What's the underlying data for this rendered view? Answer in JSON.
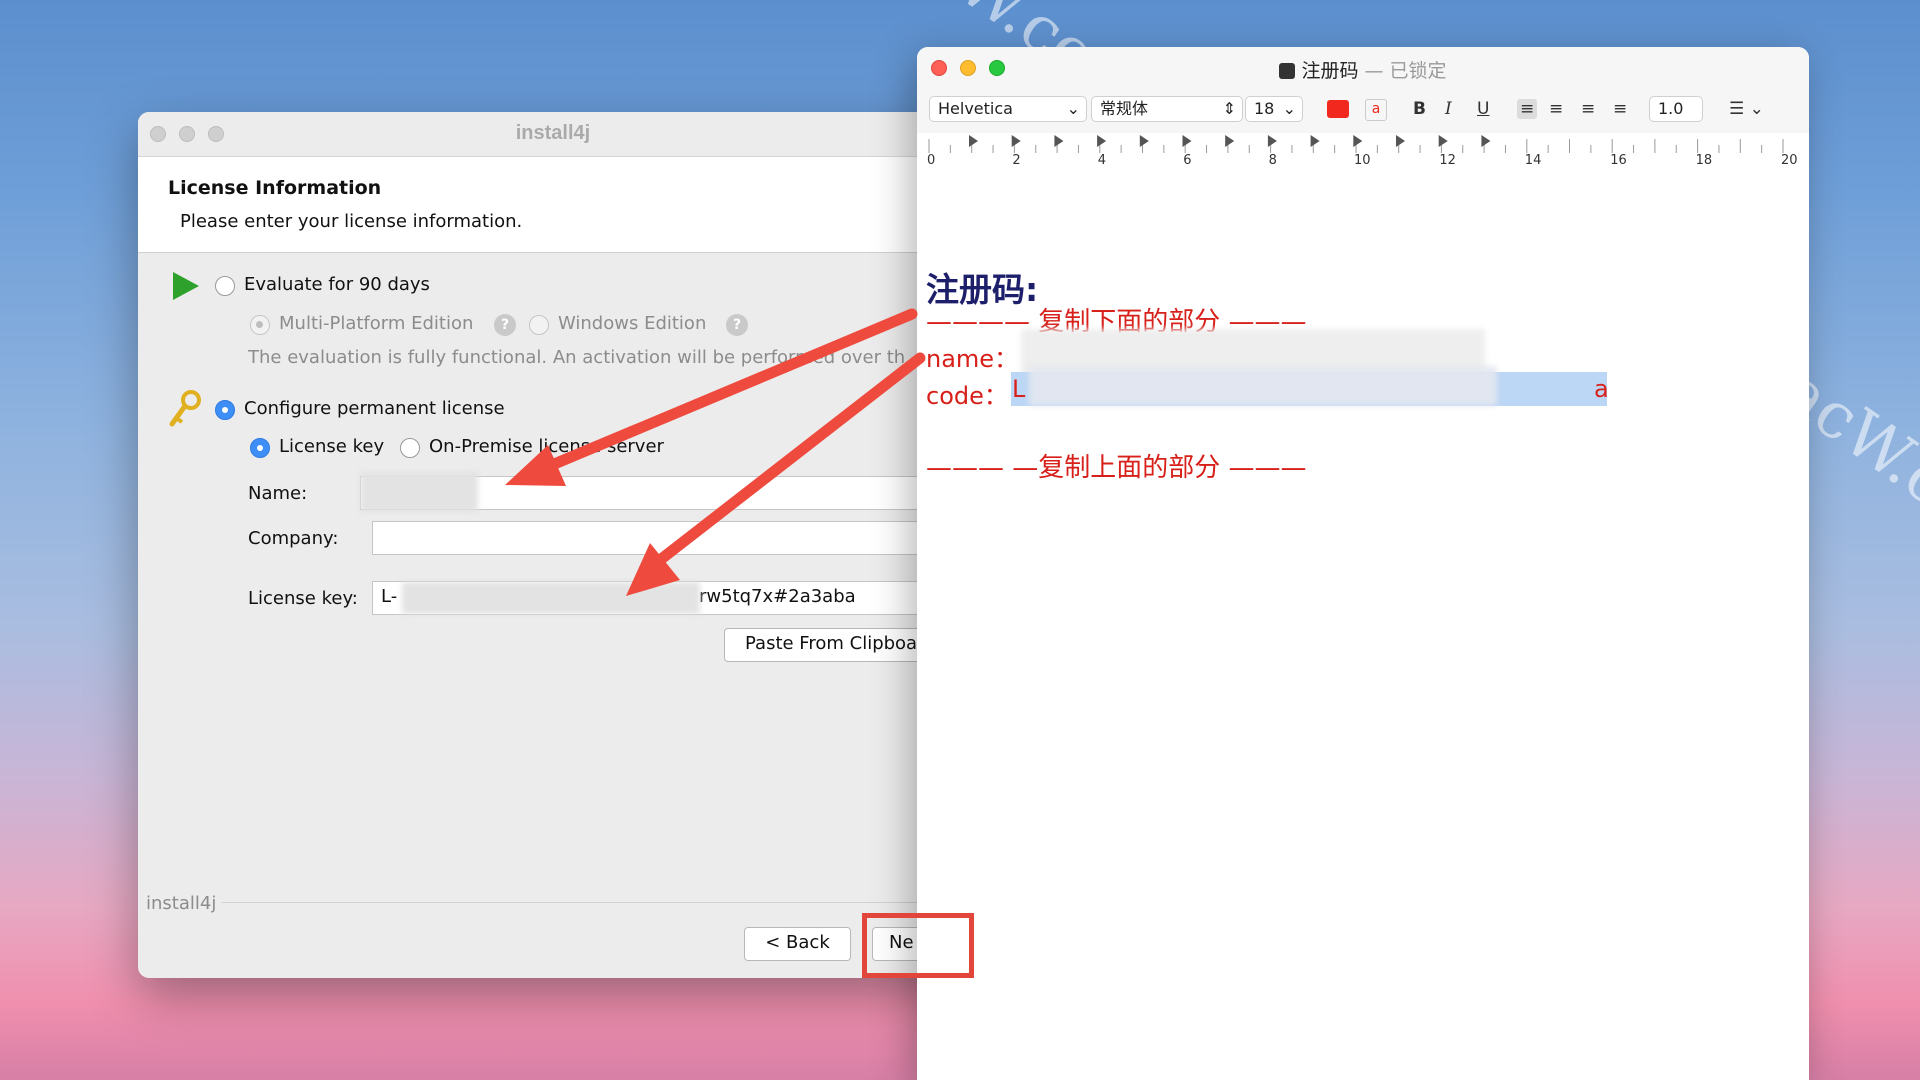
{
  "watermark": "MacW.com",
  "installer": {
    "title": "install4j",
    "header": {
      "title": "License Information",
      "subtitle": "Please enter your license information."
    },
    "evaluate": {
      "label": "Evaluate for 90 days",
      "multi_platform": "Multi-Platform Edition",
      "windows": "Windows Edition",
      "description": "The evaluation is fully functional. An activation will be performed over th"
    },
    "permanent": {
      "label": "Configure permanent license",
      "license_key_option": "License key",
      "on_premise_option": "On-Premise license server"
    },
    "form": {
      "name_label": "Name:",
      "company_label": "Company:",
      "license_key_label": "License key:",
      "license_key_prefix": "L-",
      "license_key_suffix": "rw5tq7x#2a3aba"
    },
    "buttons": {
      "paste": "Paste From Clipboa",
      "back": "< Back",
      "next": "Ne"
    },
    "footer_label": "install4j"
  },
  "textedit": {
    "title": "注册码",
    "locked": "— 已锁定",
    "toolbar": {
      "font": "Helvetica",
      "style": "常规体",
      "size": "18",
      "text_color": "#f0281e",
      "spacing": "1.0"
    },
    "ruler_labels": [
      "0",
      "2",
      "4",
      "6",
      "8",
      "10",
      "12",
      "14",
      "16",
      "18",
      "20"
    ],
    "doc": {
      "heading": "注册码:",
      "copy_below": "———— 复制下面的部分 ———",
      "name_label": "name：",
      "code_label": "code：",
      "code_visible_start": "L",
      "code_visible_end": "a",
      "copy_above": "——— —复制上面的部分 ———"
    }
  },
  "colors": {
    "accent_red": "#e2453a",
    "selection_blue": "#3d8ef7",
    "doc_red": "#d8201a",
    "doc_navy": "#1e1f6b"
  }
}
